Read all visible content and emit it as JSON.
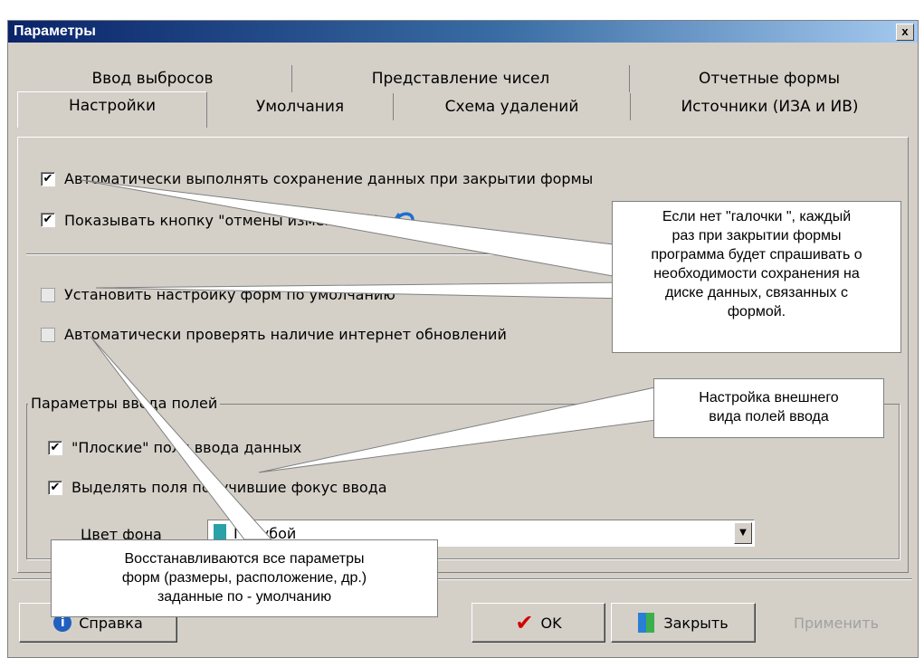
{
  "window": {
    "title": "Параметры",
    "close_glyph": "x"
  },
  "tabs_back": [
    {
      "label": "Ввод выбросов"
    },
    {
      "label": "Представление чисел"
    },
    {
      "label": "Отчетные формы"
    }
  ],
  "tabs_front": [
    {
      "label": "Настройки"
    },
    {
      "label": "Умолчания"
    },
    {
      "label": "Схема удалений"
    },
    {
      "label": "Источники (ИЗА и ИВ)"
    }
  ],
  "options": {
    "autosave": {
      "label": "Автоматически выполнять сохранение данных при закрытии формы",
      "checked": true
    },
    "show_undo": {
      "label": "Показывать кнопку \"отмены изменений\"",
      "checked": true
    },
    "default_layout": {
      "label": "Установить  настройку форм по умолчанию",
      "checked": false
    },
    "auto_update": {
      "label": "Автоматически проверять наличие интернет обновлений",
      "checked": false
    }
  },
  "input_group": {
    "title": "Параметры ввода полей",
    "flat": {
      "label": "\"Плоские\" поля ввода данных",
      "checked": true
    },
    "highlight": {
      "label": "Выделять поля получившие фокус ввода",
      "checked": true
    },
    "bg_color_label": "Цвет фона",
    "bg_color_value": "Голубой",
    "dropdown_glyph": "▼"
  },
  "buttons": {
    "help": "Справка",
    "ok": "OK",
    "close": "Закрыть",
    "apply": "Применить"
  },
  "callouts": {
    "autosave_note": [
      "Если нет \"галочки \", каждый",
      "раз при закрытии формы",
      "программа будет спрашивать о",
      "необходимости сохранения на",
      "диске данных, связанных с",
      "формой."
    ],
    "appearance_note": [
      "Настройка внешнего",
      "вида полей ввода"
    ],
    "restore_note": [
      "Восстанавливаются все параметры",
      "форм (размеры, расположение, др.)",
      "заданные по - умолчанию"
    ]
  },
  "colors": {
    "title_gradient_start": "#0a246a",
    "dialog_face": "#d4d0c8",
    "ok_check": "#d40000",
    "undo_icon": "#1e6fd0"
  }
}
